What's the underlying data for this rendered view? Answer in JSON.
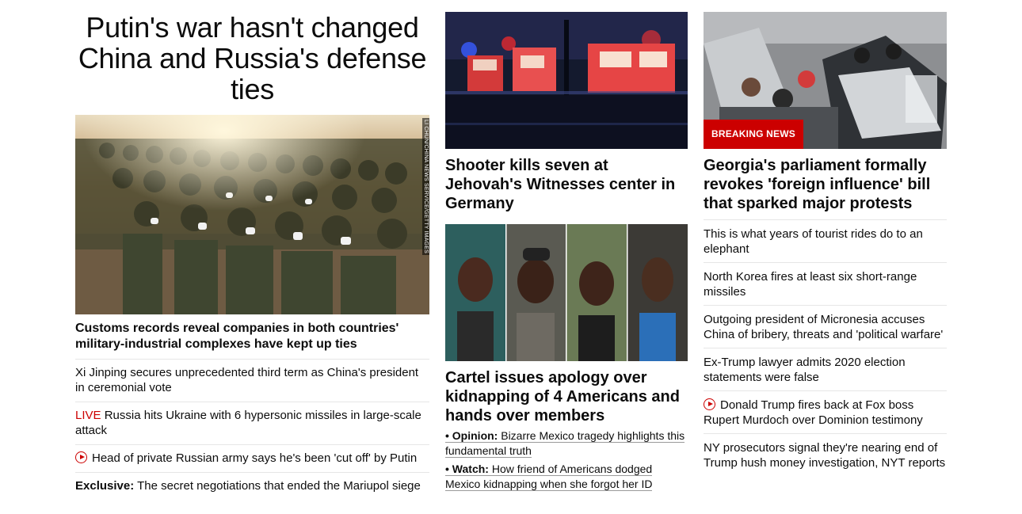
{
  "lead": {
    "headline": "Putin's war hasn't changed China and Russia's defense ties",
    "photo_credit": "LI CHUN/CHINA NEWS SERVICE/GETTY IMAGES",
    "summary": "Customs records reveal companies in both countries' military-industrial complexes have kept up ties",
    "related": [
      {
        "text": "Xi Jinping secures unprecedented third term as China's president in ceremonial vote"
      },
      {
        "prefix": "LIVE",
        "text": "Russia hits Ukraine with 6 hypersonic missiles in large-scale attack"
      },
      {
        "text": "Head of private Russian army says he's been 'cut off' by Putin"
      },
      {
        "prefix": "Exclusive:",
        "text": "The secret negotiations that ended the Mariupol siege"
      }
    ]
  },
  "middle": {
    "story1": {
      "title": "Shooter kills seven at Jehovah's Witnesses center in Germany"
    },
    "story2": {
      "title": "Cartel issues apology over kidnapping of 4 Americans and hands over members",
      "bullets": [
        {
          "label": "Opinion:",
          "text": "Bizarre Mexico tragedy highlights this fundamental truth"
        },
        {
          "label": "Watch:",
          "text": "How friend of Americans dodged Mexico kidnapping when she forgot her ID"
        }
      ]
    }
  },
  "right": {
    "badge": "BREAKING NEWS",
    "title": "Georgia's parliament formally revokes 'foreign influence' bill that sparked major protests",
    "items": [
      {
        "text": "This is what years of tourist rides do to an elephant"
      },
      {
        "text": "North Korea fires at least six short-range missiles"
      },
      {
        "text": "Outgoing president of Micronesia accuses China of bribery, threats and 'political warfare'"
      },
      {
        "text": "Ex-Trump lawyer admits 2020 election statements were false"
      },
      {
        "text": "Donald Trump fires back at Fox boss Rupert Murdoch over Dominion testimony"
      },
      {
        "text": "NY prosecutors signal they're nearing end of Trump hush money investigation, NYT reports"
      }
    ]
  },
  "colors": {
    "accent": "#cc0000",
    "divider": "#e6e6e6",
    "text": "#0c0c0c"
  },
  "icons": {
    "video": "play-icon"
  }
}
